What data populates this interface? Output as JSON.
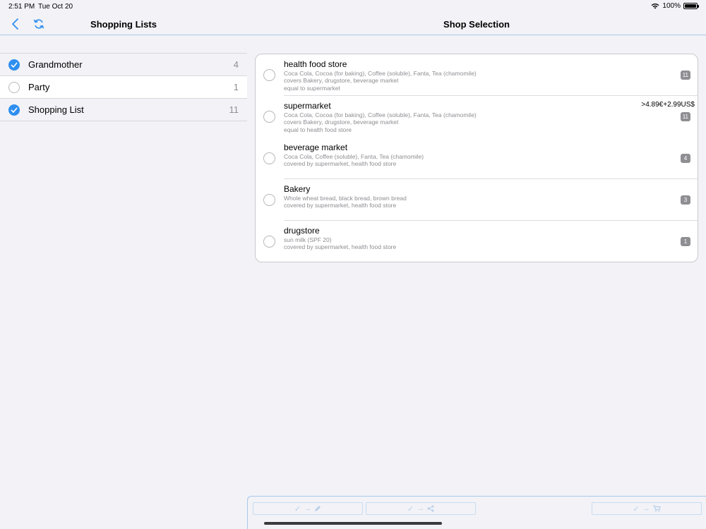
{
  "status_bar": {
    "time": "2:51 PM",
    "date": "Tue Oct 20",
    "battery": "100%",
    "battery_level": 1.0
  },
  "nav": {
    "left_title": "Shopping Lists",
    "right_title": "Shop Selection",
    "back_icon": "chevron-left-icon",
    "refresh_icon": "refresh-icon",
    "accent": "#2f8fef"
  },
  "lists": [
    {
      "label": "Grandmother",
      "count": "4",
      "checked": true
    },
    {
      "label": "Party",
      "count": "1",
      "checked": false
    },
    {
      "label": "Shopping List",
      "count": "11",
      "checked": true
    }
  ],
  "shops": [
    {
      "name": "health food store",
      "items": "Coca Cola, Cocoa (for baking), Coffee (soluble), Fanta, Tea (chamomile)",
      "line2": "covers Bakery, drugstore, beverage market",
      "line3": "equal to supermarket",
      "badge": "11",
      "price": ""
    },
    {
      "name": "supermarket",
      "items": "Coca Cola, Cocoa (for baking), Coffee (soluble), Fanta, Tea (chamomile)",
      "line2": "covers Bakery, drugstore, beverage market",
      "line3": "equal to health food store",
      "badge": "11",
      "price": ">4.89€+2.99US$"
    },
    {
      "name": "beverage market",
      "items": "Coca Cola, Coffee (soluble), Fanta, Tea (chamomile)",
      "line2": "covered by supermarket, health food store",
      "line3": "",
      "badge": "4",
      "price": ""
    },
    {
      "name": "Bakery",
      "items": "Whole wheat bread, black bread, brown bread",
      "line2": "covered by supermarket, health food store",
      "line3": "",
      "badge": "3",
      "price": ""
    },
    {
      "name": "drugstore",
      "items": "sun milk (SPF 20)",
      "line2": "covered by supermarket, health food store",
      "line3": "",
      "badge": "1",
      "price": ""
    }
  ],
  "toolbar": {
    "buttons": [
      {
        "icons": [
          "checkmark-icon",
          "arrow-right-icon",
          "pencil-icon"
        ],
        "glyphs": "✓ → ✎"
      },
      {
        "icons": [
          "checkmark-icon",
          "arrow-right-icon",
          "share-icon"
        ],
        "glyphs": "✓ → ⋖"
      },
      {
        "icons": [
          "checkmark-icon",
          "arrow-right-icon",
          "cart-icon"
        ],
        "glyphs": "✓ → 🛒"
      }
    ]
  }
}
